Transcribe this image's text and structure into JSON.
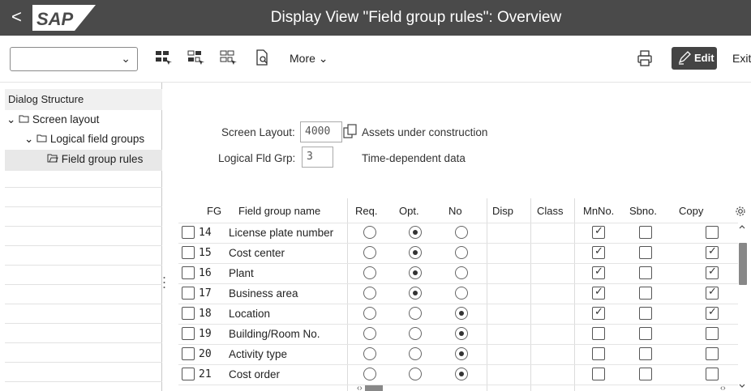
{
  "titlebar": {
    "back": "<",
    "logo_text": "SAP",
    "title": "Display View \"Field group rules\": Overview"
  },
  "toolbar": {
    "dropdown_value": "",
    "more_label": "More",
    "edit_label": "Edit",
    "exit_label": "Exit",
    "icons": [
      "select-all-icon",
      "select-block-icon",
      "deselect-all-icon",
      "print-preview-icon",
      "printer-icon",
      "edit-pencil-icon"
    ]
  },
  "dialog_structure": {
    "header": "Dialog Structure",
    "nodes": [
      {
        "label": "Screen layout",
        "level": 0,
        "expanded": true,
        "selected": false
      },
      {
        "label": "Logical field groups",
        "level": 1,
        "expanded": true,
        "selected": false
      },
      {
        "label": "Field group rules",
        "level": 2,
        "expanded": false,
        "selected": true
      }
    ]
  },
  "header_fields": {
    "screen_layout_label": "Screen Layout:",
    "screen_layout_value": "4000",
    "screen_layout_desc": "Assets under construction",
    "logical_fld_grp_label": "Logical Fld Grp:",
    "logical_fld_grp_value": "3",
    "logical_fld_grp_desc": "Time-dependent data"
  },
  "table": {
    "columns": [
      "FG",
      "Field group name",
      "Req.",
      "Opt.",
      "No",
      "Disp",
      "Class",
      "MnNo.",
      "Sbno.",
      "Copy"
    ],
    "rows": [
      {
        "fg": "14",
        "name": "License plate number",
        "option": "opt",
        "mnno": true,
        "sbno": false,
        "copy": false
      },
      {
        "fg": "15",
        "name": "Cost center",
        "option": "opt",
        "mnno": true,
        "sbno": false,
        "copy": true
      },
      {
        "fg": "16",
        "name": "Plant",
        "option": "opt",
        "mnno": true,
        "sbno": false,
        "copy": true
      },
      {
        "fg": "17",
        "name": "Business area",
        "option": "opt",
        "mnno": true,
        "sbno": false,
        "copy": true
      },
      {
        "fg": "18",
        "name": "Location",
        "option": "no",
        "mnno": true,
        "sbno": false,
        "copy": true
      },
      {
        "fg": "19",
        "name": "Building/Room No.",
        "option": "no",
        "mnno": false,
        "sbno": false,
        "copy": false
      },
      {
        "fg": "20",
        "name": "Activity type",
        "option": "no",
        "mnno": false,
        "sbno": false,
        "copy": false
      },
      {
        "fg": "21",
        "name": "Cost order",
        "option": "no",
        "mnno": false,
        "sbno": false,
        "copy": false
      }
    ]
  },
  "colors": {
    "titlebar_bg": "#4a4a4a",
    "edit_button_bg": "#444444",
    "scroll_thumb": "#888888"
  }
}
